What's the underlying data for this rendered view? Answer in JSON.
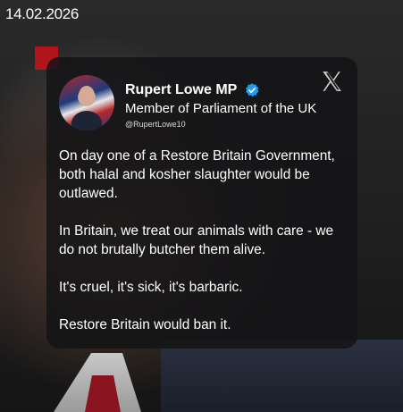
{
  "date": "14.02.2026",
  "colors": {
    "accent_red": "#b0151c",
    "card_bg": "#141416",
    "verified_blue": "#1d9bf0",
    "text": "#ffffff"
  },
  "post": {
    "author_name": "Rupert Lowe MP",
    "author_title": "Member of Parliament of the UK",
    "handle": "@RupertLowe10",
    "verified": true,
    "platform_icon": "x-logo-icon",
    "paragraphs": [
      "On day one of a Restore Britain Government, both halal and kosher slaughter would be outlawed.",
      "In Britain, we treat our animals with care - we do not brutally butcher them alive.",
      "It's cruel, it's sick, it's barbaric.",
      "Restore Britain would ban it."
    ]
  }
}
